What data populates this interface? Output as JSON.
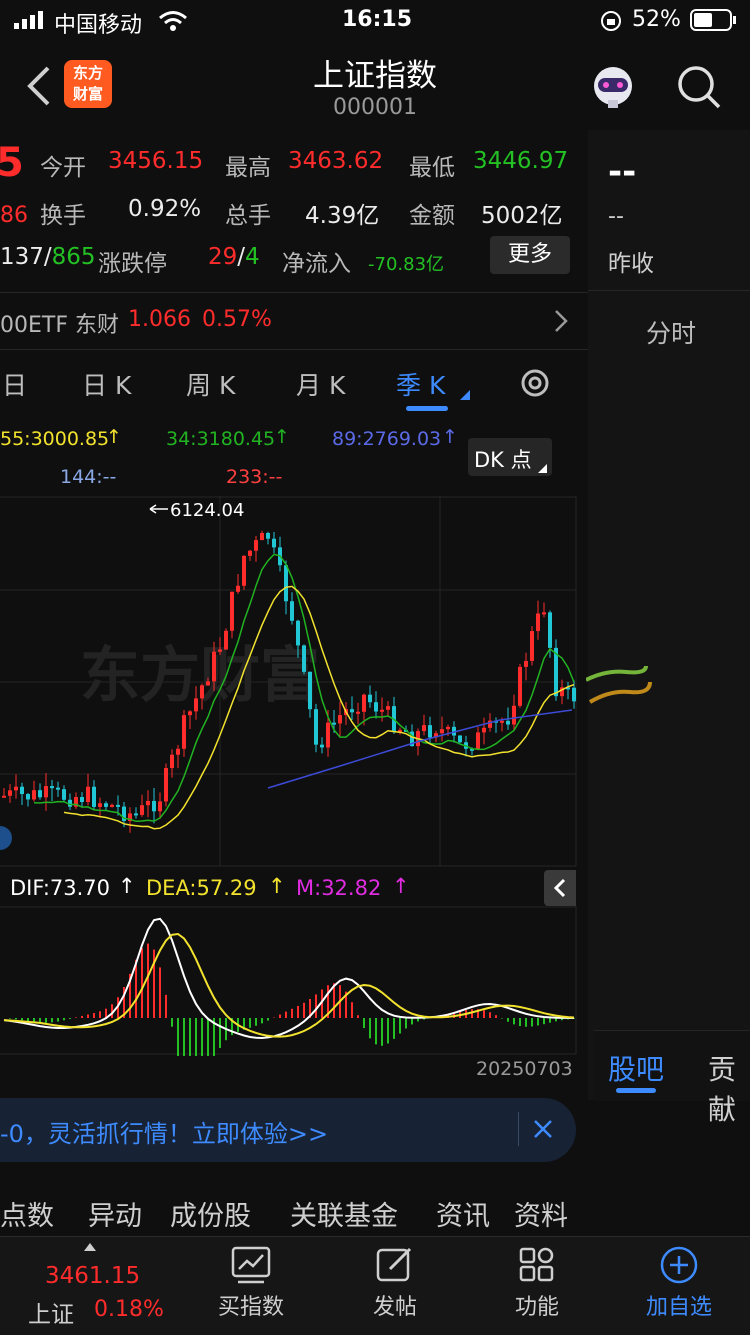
{
  "status_bar": {
    "carrier": "中国移动",
    "time": "16:15",
    "battery": "52%"
  },
  "header": {
    "title": "上证指数",
    "code": "000001",
    "logo_text_1": "东方",
    "logo_text_2": "财富"
  },
  "quote": {
    "price_fragment": "5",
    "change_fragment": "86",
    "open_label": "今开",
    "open": "3456.15",
    "high_label": "最高",
    "high": "3463.62",
    "low_label": "最低",
    "low": "3446.97",
    "turnover_label": "换手",
    "turnover": "0.92%",
    "volume_label": "总手",
    "volume": "4.39亿",
    "amount_label": "金额",
    "amount": "5002亿",
    "updown_prefix": "137/",
    "updown_down": "865",
    "limit_label": "涨跌停",
    "limit_up": "29",
    "limit_sep": "/",
    "limit_down": "4",
    "netflow_label": "净流入",
    "netflow": "-70.83亿",
    "more_button": "更多"
  },
  "etf": {
    "name": "00ETF 东财",
    "price": "1.066",
    "pct": "0.57%"
  },
  "tabs": [
    {
      "label": "日"
    },
    {
      "label": "日 K"
    },
    {
      "label": "周 K"
    },
    {
      "label": "月 K"
    },
    {
      "label": "季 K"
    }
  ],
  "ma_legend": {
    "ma55": "55:3000.85",
    "ma34": "34:3180.45",
    "ma89": "89:2769.03",
    "ma144": "144:--",
    "ma233": "233:--",
    "dk_button": "DK 点"
  },
  "chart_data": {
    "type": "candlestick",
    "title": "",
    "annotations": [
      {
        "text": "6124.04",
        "series": "high_peak"
      }
    ],
    "watermark": "东方财富",
    "ma_values": {
      "MA55": 3000.85,
      "MA34": 3180.45,
      "MA89": 2769.03,
      "MA144": null,
      "MA233": null
    },
    "colors": {
      "up": "#ff2c2c",
      "down": "#22c7d6",
      "ma34": "#21b321",
      "ma55": "#f2e22e",
      "ma89": "#3c4bd6"
    }
  },
  "macd": {
    "dif": "DIF:73.70",
    "dea": "DEA:57.29",
    "m": "M:32.82",
    "date": "20250703",
    "values": {
      "DIF": 73.7,
      "DEA": 57.29,
      "M": 32.82
    }
  },
  "right_panel": {
    "price_placeholder": "--",
    "sub_placeholder": "--",
    "prev_close_label": "昨收",
    "tab_label": "分时",
    "guba": "股吧",
    "contrib": "贡献"
  },
  "notice": {
    "text": "-0，灵活抓行情！立即体验>>"
  },
  "subnav": [
    "点数",
    "异动",
    "成份股",
    "关联基金",
    "资讯",
    "资料"
  ],
  "bottom_bar": {
    "index_price": "3461.15",
    "index_name": "上证",
    "index_pct": "0.18%",
    "buy": "买指数",
    "post": "发帖",
    "func": "功能",
    "add": "加自选"
  }
}
